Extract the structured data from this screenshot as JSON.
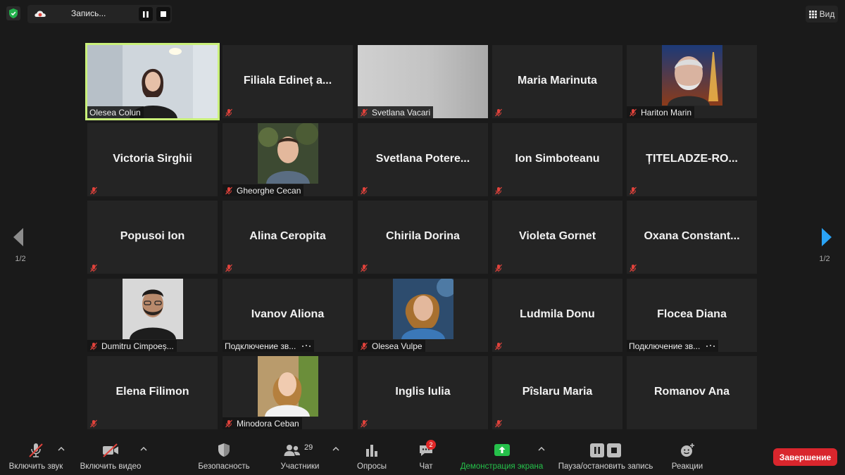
{
  "top": {
    "recording_label": "Запись...",
    "view_label": "Вид"
  },
  "nav": {
    "left_page": "1/2",
    "right_page": "1/2"
  },
  "tiles": [
    {
      "name": "Olesea Colun",
      "label": "Olesea Colun",
      "kind": "video",
      "muted": false,
      "active": true
    },
    {
      "name": "Filiala Edineț a...",
      "kind": "name",
      "muted": true
    },
    {
      "name": "Svetlana Vacari",
      "label": "Svetlana Vacari",
      "kind": "video-blank",
      "muted": true
    },
    {
      "name": "Maria Marinuta",
      "kind": "name",
      "muted": true
    },
    {
      "name": "Hariton Marin",
      "label": "Hariton Marin",
      "kind": "photo",
      "photo": "man-eiffel",
      "muted": true
    },
    {
      "name": "Victoria Sirghii",
      "kind": "name",
      "muted": true
    },
    {
      "name": "Gheorghe Cecan",
      "label": "Gheorghe Cecan",
      "kind": "photo",
      "photo": "man-young",
      "muted": true
    },
    {
      "name": "Svetlana  Potere...",
      "kind": "name",
      "muted": true
    },
    {
      "name": "Ion Simboteanu",
      "kind": "name",
      "muted": true
    },
    {
      "name": "ȚITELADZE-RO...",
      "kind": "name",
      "muted": true
    },
    {
      "name": "Popusoi Ion",
      "kind": "name",
      "muted": true
    },
    {
      "name": "Alina Ceropita",
      "kind": "name",
      "muted": true
    },
    {
      "name": "Chirila Dorina",
      "kind": "name",
      "muted": true
    },
    {
      "name": "Violeta Gornet",
      "kind": "name",
      "muted": true
    },
    {
      "name": "Oxana  Constant...",
      "kind": "name",
      "muted": true
    },
    {
      "name": "Dumitru Cimpoeș...",
      "label": "Dumitru Cimpoeș...",
      "kind": "photo",
      "photo": "man-beard",
      "muted": true
    },
    {
      "name": "Ivanov Aliona",
      "label": "Подключение зв...",
      "kind": "name",
      "muted": false,
      "connecting": true
    },
    {
      "name": "Olesea Vulpe",
      "label": "Olesea Vulpe",
      "kind": "photo",
      "photo": "woman-blue",
      "muted": true
    },
    {
      "name": "Ludmila Donu",
      "kind": "name",
      "muted": true
    },
    {
      "name": "Flocea Diana",
      "label": "Подключение зв...",
      "kind": "name",
      "muted": false,
      "connecting": true
    },
    {
      "name": "Elena Filimon",
      "kind": "name",
      "muted": true
    },
    {
      "name": "Minodora Ceban",
      "label": "Minodora Ceban",
      "kind": "photo",
      "photo": "woman-white",
      "muted": true
    },
    {
      "name": "Inglis  Iulia",
      "kind": "name",
      "muted": true
    },
    {
      "name": "Pîslaru Maria",
      "kind": "name",
      "muted": true
    },
    {
      "name": "Romanov Ana",
      "kind": "name",
      "muted": false
    }
  ],
  "toolbar": {
    "audio": "Включить звук",
    "video": "Включить видео",
    "security": "Безопасность",
    "participants": "Участники",
    "participants_count": "29",
    "polls": "Опросы",
    "chat": "Чат",
    "chat_badge": "2",
    "share": "Демонстрация экрана",
    "record": "Пауза/остановить запись",
    "reactions": "Реакции",
    "end": "Завершение"
  },
  "colors": {
    "background": "#1a1a1a",
    "tile": "#242424",
    "active_border": "#c9f07a",
    "mute_red": "#e0423b",
    "share_green": "#25c04a",
    "end_red": "#d9262d",
    "nav_blue": "#2aa3f5"
  }
}
